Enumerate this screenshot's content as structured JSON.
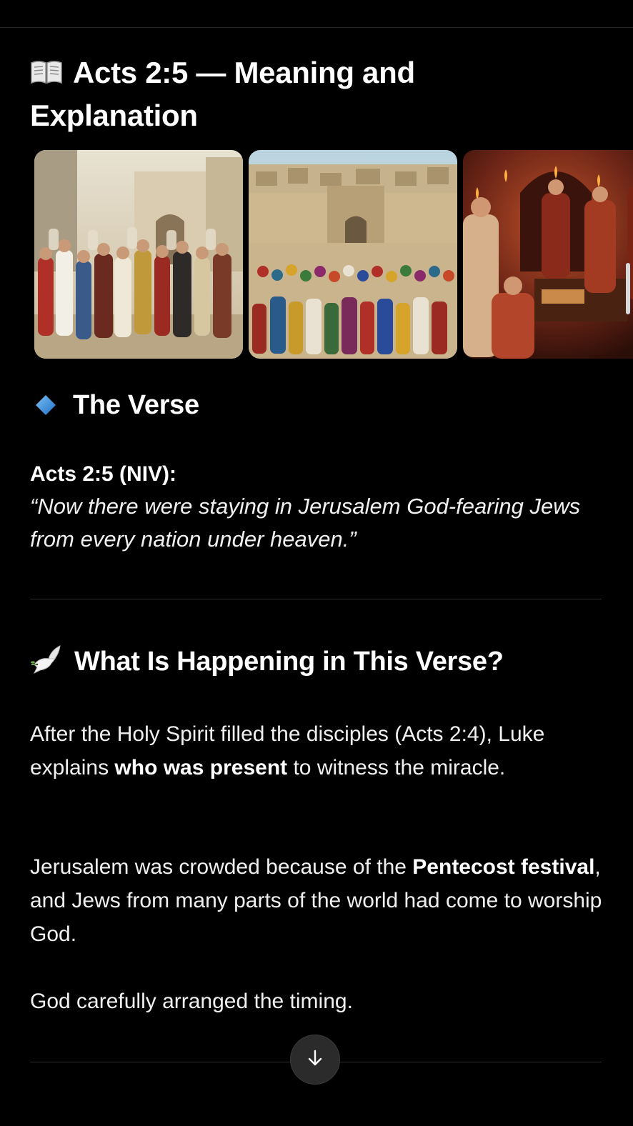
{
  "article": {
    "title": "Acts 2:5 — Meaning and Explanation",
    "title_icon": "open-book-icon",
    "gallery": [
      {
        "name": "crowd-street-image"
      },
      {
        "name": "jerusalem-square-image"
      },
      {
        "name": "upper-room-image"
      }
    ]
  },
  "section_verse": {
    "icon": "blue-diamond-icon",
    "heading": "The Verse",
    "reference": "Acts 2:5 (NIV):",
    "quote": "“Now there were staying in Jerusalem God-fearing Jews from every nation under heaven.”"
  },
  "section_happening": {
    "icon": "dove-icon",
    "heading": "What Is Happening in This Verse?",
    "p1": {
      "a": "After the Holy Spirit filled the disciples (Acts 2:4), Luke explains ",
      "b": "who was present",
      "c": " to witness the miracle."
    },
    "p2": {
      "a": "Jerusalem was crowded because of the ",
      "b": "Pentecost festival",
      "c": ", and Jews from many parts of the world had come to worship God."
    },
    "p3": "God carefully arranged the timing."
  },
  "controls": {
    "scroll_down_icon": "arrow-down-icon"
  },
  "colors": {
    "background": "#000000",
    "text": "#f0f0f0",
    "diamond": "#3a8dde",
    "button": "#2b2b2b"
  }
}
